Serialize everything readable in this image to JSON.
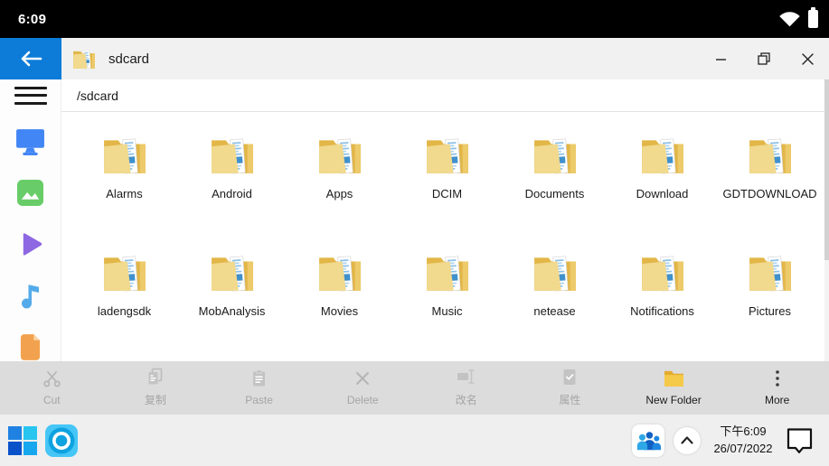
{
  "status_bar": {
    "time": "6:09"
  },
  "window": {
    "title": "sdcard",
    "path": "/sdcard"
  },
  "folders": [
    "Alarms",
    "Android",
    "Apps",
    "DCIM",
    "Documents",
    "Download",
    "GDTDOWNLOAD",
    "ladengsdk",
    "MobAnalysis",
    "Movies",
    "Music",
    "netease",
    "Notifications",
    "Pictures"
  ],
  "toolbar": {
    "items": [
      {
        "label": "Cut",
        "icon": "scissors-icon",
        "enabled": false
      },
      {
        "label": "复制",
        "icon": "copy-icon",
        "enabled": false
      },
      {
        "label": "Paste",
        "icon": "clipboard-icon",
        "enabled": false
      },
      {
        "label": "Delete",
        "icon": "x-icon",
        "enabled": false
      },
      {
        "label": "改名",
        "icon": "rename-icon",
        "enabled": false
      },
      {
        "label": "属性",
        "icon": "properties-icon",
        "enabled": false
      },
      {
        "label": "New Folder",
        "icon": "new-folder-icon",
        "enabled": true
      },
      {
        "label": "More",
        "icon": "more-dots-icon",
        "enabled": true
      }
    ]
  },
  "taskbar": {
    "time": "下午6:09",
    "date": "26/07/2022"
  },
  "colors": {
    "accent_blue": "#0d7cd8",
    "folder_back": "#e2b647",
    "folder_front": "#f1d98e",
    "status_bar_bg": "#000000",
    "toolbar_bg": "#dcdcdc",
    "taskbar_bg": "#efefef"
  }
}
